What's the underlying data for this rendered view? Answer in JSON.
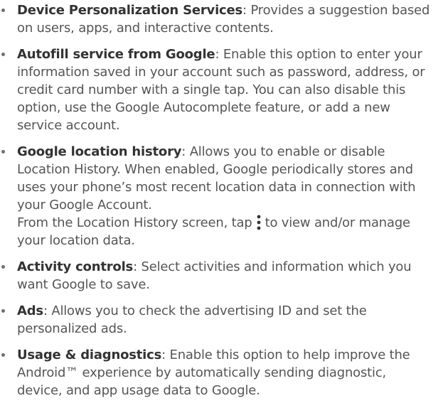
{
  "items": [
    {
      "term": "Device Personalization Services",
      "sep": ": ",
      "desc": "Provides a suggestion based on users, apps, and interactive contents."
    },
    {
      "term": "Autofill service from Google",
      "sep": ": ",
      "desc": "Enable this option to enter your information saved in your account such as password, address, or credit card number with a single tap. You can also disable this option, use the Google Autocomplete feature, or add a new service account."
    },
    {
      "term": "Google location history",
      "sep": ": ",
      "desc": "Allows you to enable or disable Location History. When enabled, Google periodically stores and uses your phone’s most recent location data in connection with your Google Account.",
      "extra_before": "From the Location History screen, tap",
      "extra_icon": "more-vertical-icon",
      "extra_after": "to view and/or manage your location data."
    },
    {
      "term": "Activity controls",
      "sep": ": ",
      "desc": "Select activities and information which you want Google to save."
    },
    {
      "term": "Ads",
      "sep": ": ",
      "desc": "Allows you to check the advertising ID and set the personalized ads."
    },
    {
      "term": "Usage & diagnostics",
      "sep": ": ",
      "desc": "Enable this option to help improve the Android™ experience by automatically sending diagnostic, device, and app usage data to Google."
    }
  ]
}
